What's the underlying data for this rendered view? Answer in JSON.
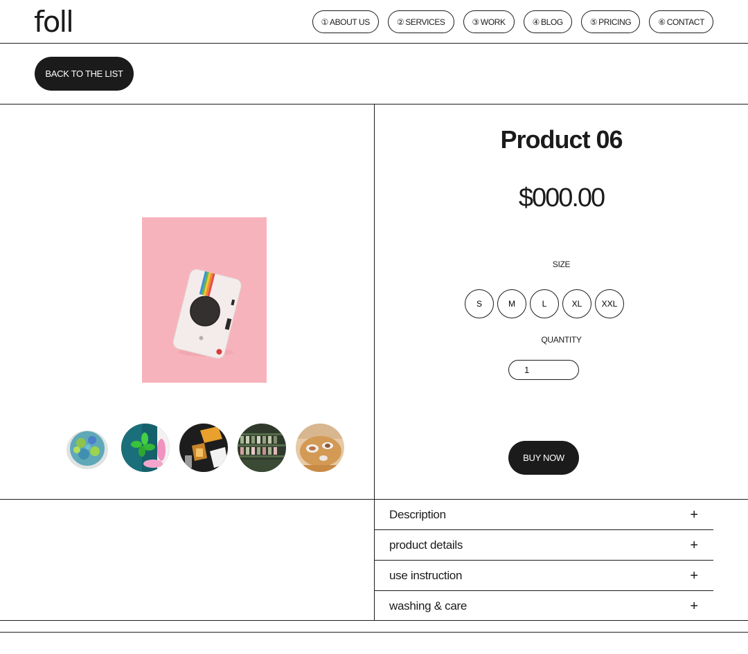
{
  "header": {
    "logo": "foll",
    "nav": [
      {
        "num": "①",
        "label": "ABOUT US"
      },
      {
        "num": "②",
        "label": "SERVICES"
      },
      {
        "num": "③",
        "label": "WORK"
      },
      {
        "num": "④",
        "label": "BLOG"
      },
      {
        "num": "⑤",
        "label": "PRICING"
      },
      {
        "num": "⑥",
        "label": "CONTACT"
      }
    ]
  },
  "back_button": "BACK TO THE LIST",
  "product": {
    "title": "Product 06",
    "price": "$000.00",
    "size_label": "SIZE",
    "sizes": [
      "S",
      "M",
      "L",
      "XL",
      "XXL"
    ],
    "quantity_label": "QUANTITY",
    "quantity_value": "1",
    "buy_button": "BUY NOW",
    "main_image_icon": "instant-camera-photo",
    "thumbnails": [
      "blue-clay-bowl-photo",
      "balloon-dog-photo",
      "desk-items-photo",
      "shelf-store-photo",
      "cafe-table-photo"
    ]
  },
  "accordion": [
    {
      "label": "Description",
      "icon": "plus-icon",
      "sign": "+"
    },
    {
      "label": "product details",
      "icon": "plus-icon",
      "sign": "+"
    },
    {
      "label": "use instruction",
      "icon": "plus-icon",
      "sign": "+"
    },
    {
      "label": "washing & care",
      "icon": "plus-icon",
      "sign": "+"
    }
  ],
  "colors": {
    "ink": "#1b1b1b",
    "background": "#ffffff",
    "photo_pink": "#f7b3bb"
  }
}
